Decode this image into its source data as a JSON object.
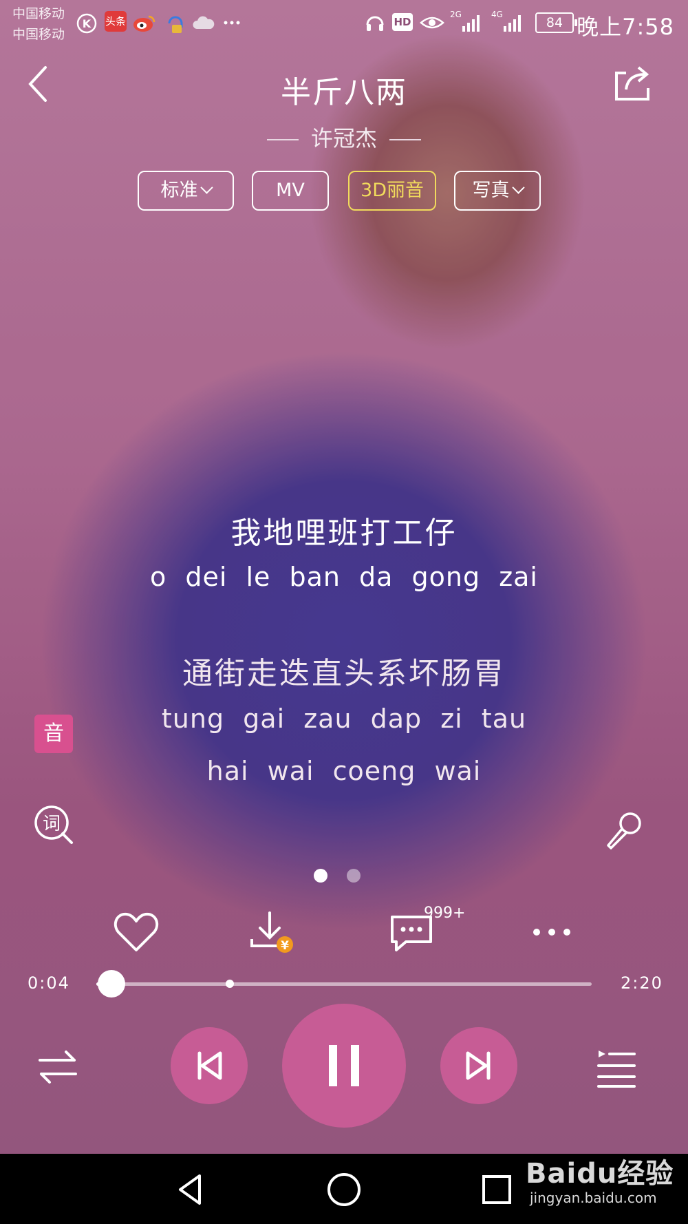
{
  "status_bar": {
    "carrier_1": "中国移动",
    "carrier_2": "中国移动",
    "battery": "84",
    "time": "晚上7:58",
    "signal_1": "2G",
    "signal_2": "4G",
    "hd": "HD",
    "app_badge": "头条"
  },
  "header": {
    "title": "半斤八两",
    "artist": "许冠杰",
    "back_icon": "chevron-left-icon",
    "share_icon": "share-icon"
  },
  "chips": [
    {
      "label": "标准",
      "has_dropdown": true
    },
    {
      "label": "MV",
      "has_dropdown": false
    },
    {
      "label": "3D丽音",
      "highlight_color": "#f1db5c"
    },
    {
      "label": "写真",
      "has_dropdown": true
    }
  ],
  "lyrics": {
    "current_cn": "我地哩班打工仔",
    "current_py": "o dei le ban da gong zai",
    "next_cn": "通街走迭直头系坏肠胃",
    "next_py_1": "tung gai zau dap zi tau",
    "next_py_2": "hai wai coeng wai"
  },
  "side": {
    "yin_label": "音",
    "ci_label": "词",
    "mic_icon": "microphone-icon"
  },
  "actions": {
    "like_icon": "heart-icon",
    "download_icon": "download-icon",
    "download_badge": "¥",
    "comment_icon": "comment-icon",
    "comment_count": "999+",
    "more_icon": "more-icon"
  },
  "progress": {
    "current": "0:04",
    "total": "2:20",
    "played_fraction": 0.03,
    "buffered_fraction": 0.27
  },
  "controls": {
    "mode_icon": "shuffle-icon",
    "prev_icon": "previous-icon",
    "play_pause_icon": "pause-icon",
    "next_icon": "next-icon",
    "playlist_icon": "playlist-icon"
  },
  "nav_bar": {
    "back_icon": "nav-back-icon",
    "home_icon": "nav-home-icon",
    "recent_icon": "nav-recent-icon"
  },
  "watermark": {
    "brand": "Baidu经验",
    "url": "jingyan.baidu.com"
  },
  "colors": {
    "accent": "#c75c95",
    "yin_badge": "#d8508f",
    "download_badge": "#f29a1e"
  }
}
